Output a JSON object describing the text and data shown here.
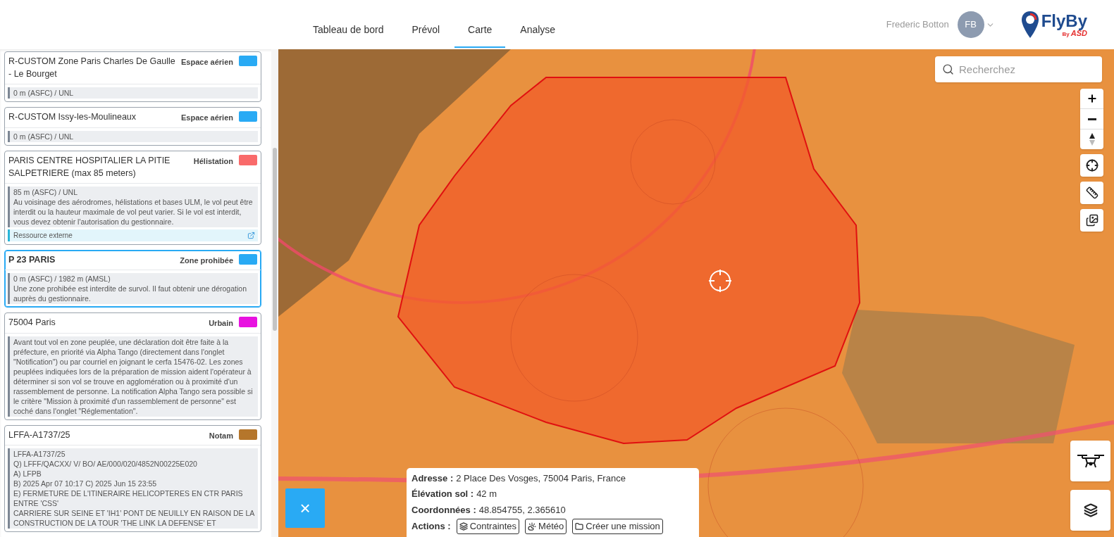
{
  "nav": {
    "tabs": [
      {
        "label": "Tableau de bord",
        "selected": false
      },
      {
        "label": "Prévol",
        "selected": false
      },
      {
        "label": "Carte",
        "selected": true
      },
      {
        "label": "Analyse",
        "selected": false
      }
    ],
    "user": {
      "name": "Frederic Botton",
      "initials": "FB"
    },
    "logo": {
      "name": "FlyBy",
      "byline": "By",
      "brand": "ASD"
    }
  },
  "zones": [
    {
      "title": "R-CUSTOM Zone Paris Charles De Gaulle - Le Bourget",
      "type": "Espace aérien",
      "color": "#29aaf4",
      "selected": false,
      "lines": [
        "0 m (ASFC) / UNL"
      ]
    },
    {
      "title": "R-CUSTOM Issy-les-Moulineaux",
      "type": "Espace aérien",
      "color": "#29aaf4",
      "selected": false,
      "lines": [
        "0 m (ASFC) / UNL"
      ]
    },
    {
      "title": "PARIS CENTRE HOSPITALIER LA PITIE SALPETRIERE (max 85 meters)",
      "type": "Hélistation",
      "color": "#f96a6a",
      "selected": false,
      "lines": [
        "85 m (ASFC) / UNL",
        "Au voisinage des aérodromes, hélistations et bases ULM, le vol peut être interdit ou la hauteur maximale de vol peut varier. Si le vol est interdit, vous devez obtenir l'autorisation du gestionnaire."
      ],
      "link": "Ressource externe"
    },
    {
      "title": "P 23 PARIS",
      "type": "Zone prohibée",
      "color": "#29aaf4",
      "selected": true,
      "lines": [
        "0 m (ASFC) / 1982 m (AMSL)",
        "Une zone prohibée est interdite de survol. Il faut obtenir une dérogation auprès du gestionnaire."
      ]
    },
    {
      "title": "75004 Paris",
      "type": "Urbain",
      "color": "#e812e0",
      "selected": false,
      "lines": [
        "Avant tout vol en zone peuplée, une déclaration doit être faite à la préfecture, en priorité via Alpha Tango (directement dans l'onglet \"Notification\") ou par courriel en joignant le cerfa 15476-02. Les zones peuplées indiquées lors de la préparation de mission aident l'opérateur à déterminer si son vol se trouve en agglomération ou à proximité d'un rassemblement de personne. La notification Alpha Tango sera possible si le critère \"Mission à proximité d'un rassemblement de personne\" est coché dans l'onglet \"Réglementation\"."
      ]
    },
    {
      "title": "LFFA-A1737/25",
      "type": "Notam",
      "color": "#b5762b",
      "selected": false,
      "lines": [
        "LFFA-A1737/25",
        "Q) LFFF/QACXX/ V/ BO/ AE/000/020/4852N00225E020",
        "A) LFPB",
        "B) 2025 Apr 07 10:17 C) 2025 Jun 15 23:55",
        "E) FERMETURE DE L'ITINERAIRE HELICOPTERES EN CTR PARIS ENTRE 'CSS'",
        "CARRIERE SUR SEINE ET 'IH1' PONT DE NEUILLY EN RAISON DE LA",
        "CONSTRUCTION DE LA TOUR 'THE LINK LA DEFENSE' ET"
      ]
    }
  ],
  "search": {
    "placeholder": "Recherchez"
  },
  "info": {
    "rows": [
      {
        "label": "Adresse :",
        "value": "2 Place Des Vosges, 75004 Paris, France"
      },
      {
        "label": "Élévation sol :",
        "value": "42 m"
      },
      {
        "label": "Coordonnées :",
        "value": "48.854755, 2.365610"
      }
    ],
    "actions_label": "Actions :",
    "actions": [
      {
        "kind": "layers",
        "label": "Contraintes"
      },
      {
        "kind": "weather",
        "label": "Météo"
      },
      {
        "kind": "folder",
        "label": "Créer une mission"
      }
    ]
  },
  "close_button": {
    "label": "×"
  }
}
